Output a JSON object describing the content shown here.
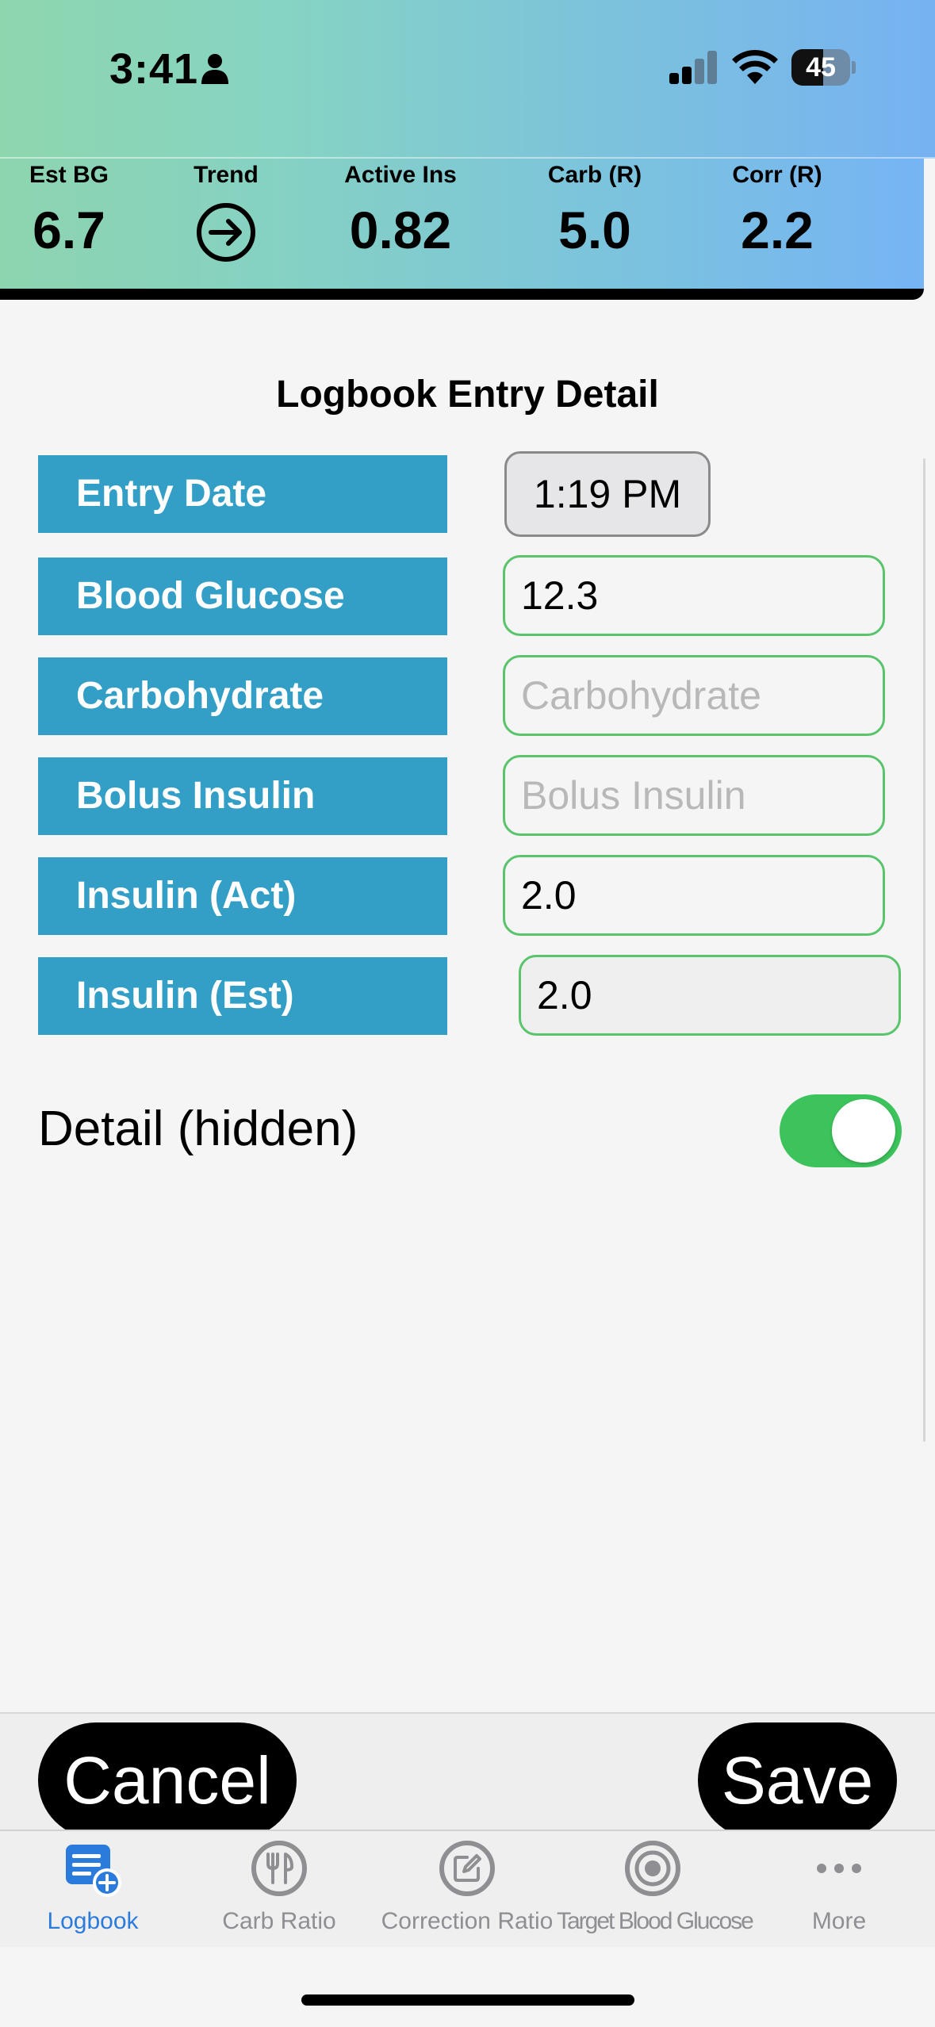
{
  "status_bar": {
    "time": "3:41",
    "battery": "45"
  },
  "stats": [
    {
      "label": "Est BG",
      "value": "6.7"
    },
    {
      "label": "Trend",
      "icon": "arrow-right-circle-icon"
    },
    {
      "label": "Active Ins",
      "value": "0.82"
    },
    {
      "label": "Carb (R)",
      "value": "5.0"
    },
    {
      "label": "Corr (R)",
      "value": "2.2"
    }
  ],
  "page_title": "Logbook Entry Detail",
  "form": {
    "entry_date": {
      "label": "Entry Date",
      "value": "1:19 PM"
    },
    "blood_glucose": {
      "label": "Blood Glucose",
      "value": "12.3"
    },
    "carbohydrate": {
      "label": "Carbohydrate",
      "placeholder": "Carbohydrate"
    },
    "bolus_insulin": {
      "label": "Bolus Insulin",
      "placeholder": "Bolus Insulin"
    },
    "insulin_act": {
      "label": "Insulin (Act)",
      "value": "2.0"
    },
    "insulin_est": {
      "label": "Insulin (Est)",
      "value": "2.0"
    }
  },
  "detail": {
    "label": "Detail (hidden)",
    "toggle_on": true
  },
  "actions": {
    "cancel": "Cancel",
    "save": "Save"
  },
  "tabs": [
    {
      "label": "Logbook",
      "icon": "logbook-add-icon",
      "active": true
    },
    {
      "label": "Carb Ratio",
      "icon": "fork-knife-icon"
    },
    {
      "label": "Correction Ratio",
      "icon": "edit-icon"
    },
    {
      "label": "Target Blood Glucose",
      "icon": "target-icon"
    },
    {
      "label": "More",
      "icon": "more-dots-icon"
    }
  ],
  "colors": {
    "accent": "#339fc6",
    "field_border": "#5ac46c",
    "toggle": "#3cc35c",
    "tab_active": "#2a7bdc"
  }
}
